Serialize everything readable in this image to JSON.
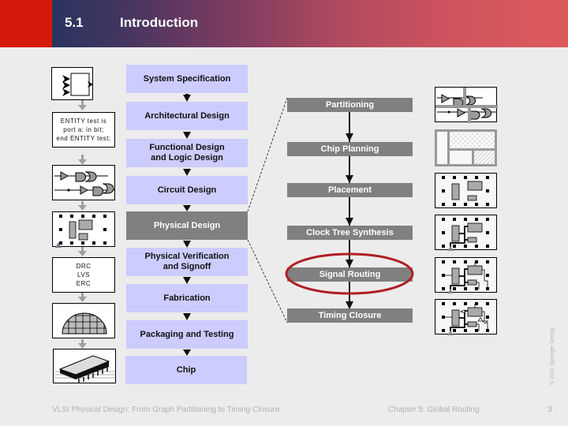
{
  "header": {
    "section_number": "5.1",
    "title": "Introduction",
    "accent_red": "#d2190a"
  },
  "flow_left": [
    {
      "label": "System Specification",
      "highlighted": false
    },
    {
      "label": "Architectural Design",
      "highlighted": false
    },
    {
      "label": "Functional Design\nand Logic Design",
      "highlighted": false
    },
    {
      "label": "Circuit Design",
      "highlighted": false
    },
    {
      "label": "Physical Design",
      "highlighted": true
    },
    {
      "label": "Physical Verification\nand Signoff",
      "highlighted": false
    },
    {
      "label": "Fabrication",
      "highlighted": false
    },
    {
      "label": "Packaging and Testing",
      "highlighted": false
    },
    {
      "label": "Chip",
      "highlighted": false
    }
  ],
  "flow_right": [
    {
      "label": "Partitioning",
      "circled": false
    },
    {
      "label": "Chip Planning",
      "circled": false
    },
    {
      "label": "Placement",
      "circled": false
    },
    {
      "label": "Clock Tree Synthesis",
      "circled": false
    },
    {
      "label": "Signal Routing",
      "circled": true
    },
    {
      "label": "Timing Closure",
      "circled": false
    }
  ],
  "left_icons": {
    "block_diagram": "block-diagram-icon",
    "hdl_text": "ENTITY test is\nport a: in bit;\nend ENTITY test;",
    "logic_gates": "logic-gates-icon",
    "layout": "layout-icon",
    "verification_text": "DRC\nLVS\nERC",
    "wafer": "wafer-icon",
    "chip_package": "chip-package-icon"
  },
  "right_icons": [
    "partitioned-netlist-icon",
    "floorplan-icon",
    "placement-icon",
    "clock-tree-icon",
    "signal-routing-icon",
    "timing-closure-icon"
  ],
  "highlight_color": "#b01e24",
  "footer": {
    "book_title": "VLSI Physical Design: From Graph Partitioning to Timing Closure",
    "chapter": "Chapter 5: Global Routing",
    "page": "3",
    "copyright": "© 2011 Springer Verlag"
  }
}
